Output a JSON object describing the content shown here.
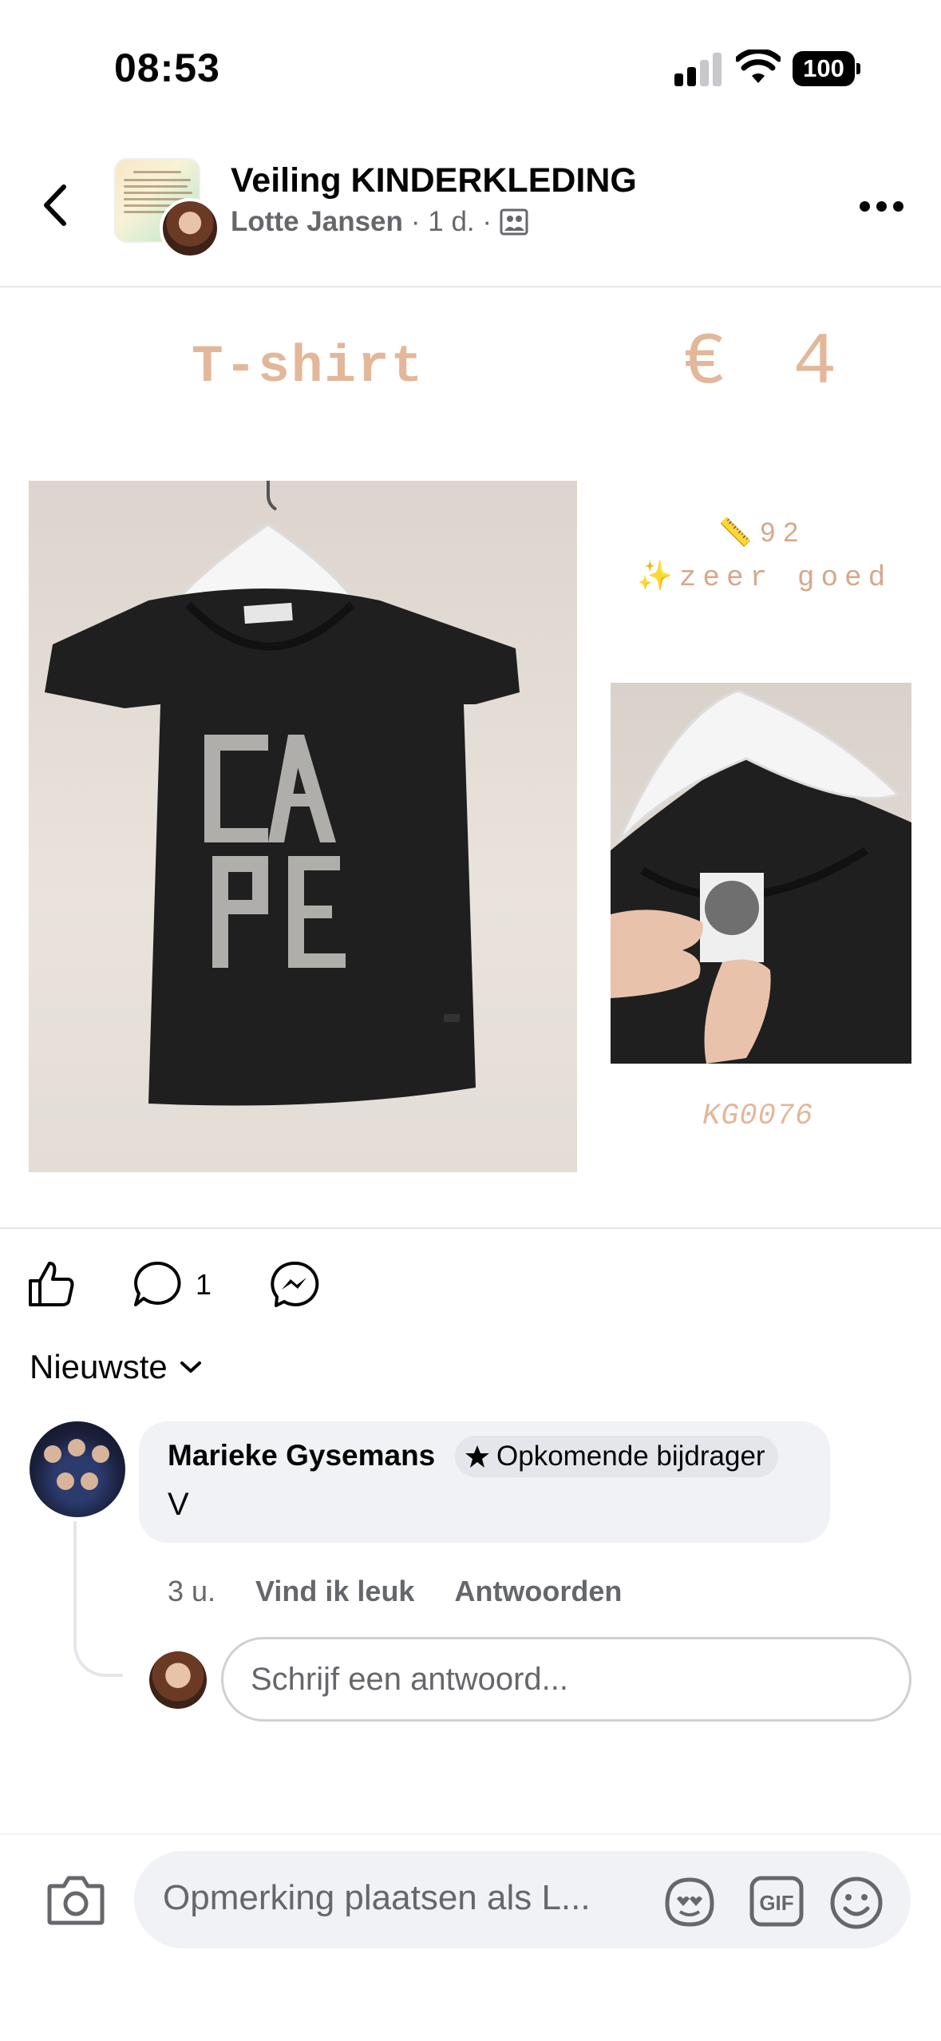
{
  "status_bar": {
    "time": "08:53",
    "battery": "100"
  },
  "header": {
    "group_title": "Veiling KINDERKLEDING",
    "author": "Lotte Jansen",
    "time_ago": "· 1 d. ·"
  },
  "post_image": {
    "item_name": "T-shirt",
    "price": "€ 4",
    "size": "📏92",
    "condition": "✨zeer goed",
    "code": "KG0076"
  },
  "actions": {
    "comment_count": "1"
  },
  "sort": {
    "label": "Nieuwste"
  },
  "comment": {
    "name": "Marieke Gysemans",
    "badge": "Opkomende bijdrager",
    "text": "V",
    "time": "3 u.",
    "like_label": "Vind ik leuk",
    "reply_label": "Antwoorden"
  },
  "reply": {
    "placeholder": "Schrijf een antwoord..."
  },
  "composer": {
    "placeholder": "Opmerking plaatsen als L..."
  },
  "colors": {
    "accent_peach": "#e3b79a",
    "secondary_text": "#65676b",
    "bubble_bg": "#f0f2f5"
  }
}
